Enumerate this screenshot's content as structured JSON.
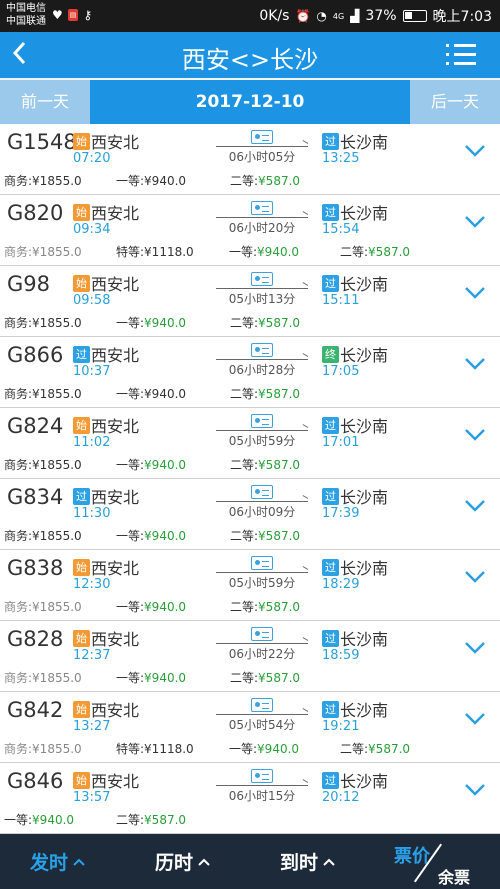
{
  "status_bar": {
    "carrier1": "中国电信",
    "carrier2": "中国联通",
    "net_speed": "0K/s",
    "signal_tag": "4G",
    "battery": "37%",
    "clock": "晚上7:03"
  },
  "nav": {
    "back": "<",
    "title": "西安<>长沙",
    "colors": {
      "nav_bg": "#1c94e3",
      "date_bg": "#1c94e3",
      "day_btn_bg": "#9ac9ec"
    }
  },
  "datebar": {
    "prev_label": "前一天",
    "date": "2017-12-10",
    "next_label": "后一天"
  },
  "trains": [
    {
      "code": "G1548",
      "from_tag": "始",
      "from_tag_color": "orange",
      "from": "西安北",
      "dep": "07:20",
      "duration": "06小时05分",
      "to_tag": "过",
      "to_tag_color": "blue",
      "to": "长沙南",
      "arr": "13:25",
      "seats": [
        {
          "l": "商务:",
          "p": "¥1855.0",
          "ok": false,
          "na": false
        },
        {
          "l": "一等:",
          "p": "¥940.0",
          "ok": false,
          "na": false
        },
        {
          "l": "二等:",
          "p": "¥587.0",
          "ok": true,
          "na": false
        }
      ],
      "seat_layout": "A"
    },
    {
      "code": "G820",
      "from_tag": "始",
      "from_tag_color": "orange",
      "from": "西安北",
      "dep": "09:34",
      "duration": "06小时20分",
      "to_tag": "过",
      "to_tag_color": "blue",
      "to": "长沙南",
      "arr": "15:54",
      "seats": [
        {
          "l": "商务:",
          "p": "¥1855.0",
          "ok": false,
          "na": true
        },
        {
          "l": "特等:",
          "p": "¥1118.0",
          "ok": false,
          "na": false
        },
        {
          "l": "一等:",
          "p": "¥940.0",
          "ok": true,
          "na": false
        },
        {
          "l": "二等:",
          "p": "¥587.0",
          "ok": true,
          "na": false
        }
      ],
      "seat_layout": "B"
    },
    {
      "code": "G98",
      "from_tag": "始",
      "from_tag_color": "orange",
      "from": "西安北",
      "dep": "09:58",
      "duration": "05小时13分",
      "to_tag": "过",
      "to_tag_color": "blue",
      "to": "长沙南",
      "arr": "15:11",
      "seats": [
        {
          "l": "商务:",
          "p": "¥1855.0",
          "ok": false,
          "na": false
        },
        {
          "l": "一等:",
          "p": "¥940.0",
          "ok": true,
          "na": false
        },
        {
          "l": "二等:",
          "p": "¥587.0",
          "ok": true,
          "na": false
        }
      ],
      "seat_layout": "A"
    },
    {
      "code": "G866",
      "from_tag": "过",
      "from_tag_color": "blue",
      "from": "西安北",
      "dep": "10:37",
      "duration": "06小时28分",
      "to_tag": "终",
      "to_tag_color": "green",
      "to": "长沙南",
      "arr": "17:05",
      "seats": [
        {
          "l": "商务:",
          "p": "¥1855.0",
          "ok": false,
          "na": false
        },
        {
          "l": "一等:",
          "p": "¥940.0",
          "ok": false,
          "na": false
        },
        {
          "l": "二等:",
          "p": "¥587.0",
          "ok": true,
          "na": false
        }
      ],
      "seat_layout": "A"
    },
    {
      "code": "G824",
      "from_tag": "始",
      "from_tag_color": "orange",
      "from": "西安北",
      "dep": "11:02",
      "duration": "05小时59分",
      "to_tag": "过",
      "to_tag_color": "blue",
      "to": "长沙南",
      "arr": "17:01",
      "seats": [
        {
          "l": "商务:",
          "p": "¥1855.0",
          "ok": false,
          "na": false
        },
        {
          "l": "一等:",
          "p": "¥940.0",
          "ok": true,
          "na": false
        },
        {
          "l": "二等:",
          "p": "¥587.0",
          "ok": true,
          "na": false
        }
      ],
      "seat_layout": "A"
    },
    {
      "code": "G834",
      "from_tag": "过",
      "from_tag_color": "blue",
      "from": "西安北",
      "dep": "11:30",
      "duration": "06小时09分",
      "to_tag": "过",
      "to_tag_color": "blue",
      "to": "长沙南",
      "arr": "17:39",
      "seats": [
        {
          "l": "商务:",
          "p": "¥1855.0",
          "ok": false,
          "na": false
        },
        {
          "l": "一等:",
          "p": "¥940.0",
          "ok": true,
          "na": false
        },
        {
          "l": "二等:",
          "p": "¥587.0",
          "ok": true,
          "na": false
        }
      ],
      "seat_layout": "A"
    },
    {
      "code": "G838",
      "from_tag": "始",
      "from_tag_color": "orange",
      "from": "西安北",
      "dep": "12:30",
      "duration": "05小时59分",
      "to_tag": "过",
      "to_tag_color": "blue",
      "to": "长沙南",
      "arr": "18:29",
      "seats": [
        {
          "l": "商务:",
          "p": "¥1855.0",
          "ok": false,
          "na": true
        },
        {
          "l": "一等:",
          "p": "¥940.0",
          "ok": true,
          "na": false
        },
        {
          "l": "二等:",
          "p": "¥587.0",
          "ok": true,
          "na": false
        }
      ],
      "seat_layout": "A"
    },
    {
      "code": "G828",
      "from_tag": "始",
      "from_tag_color": "orange",
      "from": "西安北",
      "dep": "12:37",
      "duration": "06小时22分",
      "to_tag": "过",
      "to_tag_color": "blue",
      "to": "长沙南",
      "arr": "18:59",
      "seats": [
        {
          "l": "商务:",
          "p": "¥1855.0",
          "ok": false,
          "na": true
        },
        {
          "l": "一等:",
          "p": "¥940.0",
          "ok": true,
          "na": false
        },
        {
          "l": "二等:",
          "p": "¥587.0",
          "ok": true,
          "na": false
        }
      ],
      "seat_layout": "A"
    },
    {
      "code": "G842",
      "from_tag": "始",
      "from_tag_color": "orange",
      "from": "西安北",
      "dep": "13:27",
      "duration": "05小时54分",
      "to_tag": "过",
      "to_tag_color": "blue",
      "to": "长沙南",
      "arr": "19:21",
      "seats": [
        {
          "l": "商务:",
          "p": "¥1855.0",
          "ok": false,
          "na": true
        },
        {
          "l": "特等:",
          "p": "¥1118.0",
          "ok": false,
          "na": false
        },
        {
          "l": "一等:",
          "p": "¥940.0",
          "ok": true,
          "na": false
        },
        {
          "l": "二等:",
          "p": "¥587.0",
          "ok": true,
          "na": false
        }
      ],
      "seat_layout": "B"
    },
    {
      "code": "G846",
      "from_tag": "始",
      "from_tag_color": "orange",
      "from": "西安北",
      "dep": "13:57",
      "duration": "06小时15分",
      "to_tag": "过",
      "to_tag_color": "blue",
      "to": "长沙南",
      "arr": "20:12",
      "seats": [
        {
          "l": "一等:",
          "p": "¥940.0",
          "ok": true,
          "na": false
        },
        {
          "l": "二等:",
          "p": "¥587.0",
          "ok": true,
          "na": false
        }
      ],
      "seat_layout": "C"
    }
  ],
  "bottom": {
    "depart_label": "发时",
    "duration_label": "历时",
    "arrive_label": "到时",
    "fare_label": "票价",
    "remaining_label": "余票",
    "caret": "^",
    "active_color": "#2aa0e8"
  }
}
